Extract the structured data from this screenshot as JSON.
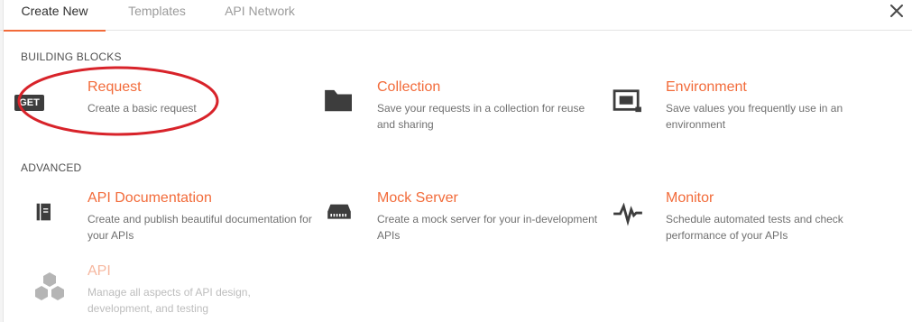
{
  "tabs": [
    {
      "label": "Create New",
      "active": true
    },
    {
      "label": "Templates",
      "active": false
    },
    {
      "label": "API Network",
      "active": false
    }
  ],
  "sections": {
    "building_blocks": "BUILDING BLOCKS",
    "advanced": "ADVANCED"
  },
  "cards": {
    "request": {
      "title": "Request",
      "desc": "Create a basic request",
      "badge": "GET",
      "icon": "get-badge-icon"
    },
    "collection": {
      "title": "Collection",
      "desc": "Save your requests in a collection for reuse and sharing",
      "icon": "folder-icon"
    },
    "environment": {
      "title": "Environment",
      "desc": "Save values you frequently use in an environment",
      "icon": "environment-icon"
    },
    "apidoc": {
      "title": "API Documentation",
      "desc": "Create and publish beautiful documentation for your APIs",
      "icon": "book-icon"
    },
    "mock": {
      "title": "Mock Server",
      "desc": "Create a mock server for your in-development APIs",
      "icon": "server-icon"
    },
    "monitor": {
      "title": "Monitor",
      "desc": "Schedule automated tests and check performance of your APIs",
      "icon": "pulse-icon"
    },
    "api": {
      "title": "API",
      "desc": "Manage all aspects of API design, development, and testing",
      "icon": "hexagons-icon"
    }
  },
  "colors": {
    "accent": "#f26b3a",
    "highlight_ellipse": "#d8232a",
    "icon": "#3d3d3d"
  }
}
